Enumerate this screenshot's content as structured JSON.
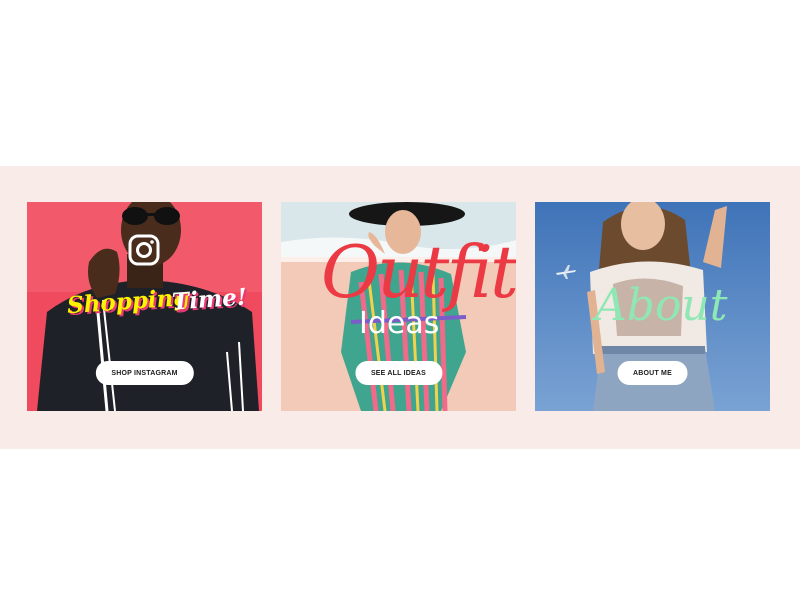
{
  "cards": [
    {
      "overlay_word_1": "Shopping",
      "overlay_word_2": "Time!",
      "button_label": "SHOP INSTAGRAM"
    },
    {
      "overlay_large": "Outfit",
      "overlay_small": "Ideas",
      "button_label": "SEE ALL IDEAS"
    },
    {
      "overlay_text": "About",
      "button_label": "ABOUT ME"
    }
  ],
  "colors": {
    "band": "#f9ece8",
    "card1_bg": "#ef4a5e",
    "card2_bg": "#f3c9b7",
    "card3_sky": "#4a7bbd",
    "shopping_yellow": "#fff200",
    "outfit_red": "#ec3a45",
    "about_mint": "#8fe8b4"
  },
  "icons": [
    "instagram-icon",
    "airplane-icon"
  ]
}
